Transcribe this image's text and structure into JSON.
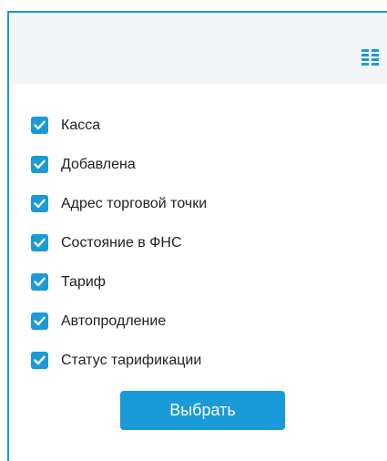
{
  "header": {
    "columns_icon": "columns-list-icon"
  },
  "options": [
    {
      "label": "Касса",
      "checked": true
    },
    {
      "label": "Добавлена",
      "checked": true
    },
    {
      "label": "Адрес торговой точки",
      "checked": true
    },
    {
      "label": "Состояние в ФНС",
      "checked": true
    },
    {
      "label": "Тариф",
      "checked": true
    },
    {
      "label": "Автопродление",
      "checked": true
    },
    {
      "label": "Статус тарификации",
      "checked": true
    }
  ],
  "actions": {
    "select_label": "Выбрать"
  },
  "colors": {
    "accent": "#1a9ad8",
    "header_bg": "#f4f5f6",
    "text": "#222222"
  }
}
